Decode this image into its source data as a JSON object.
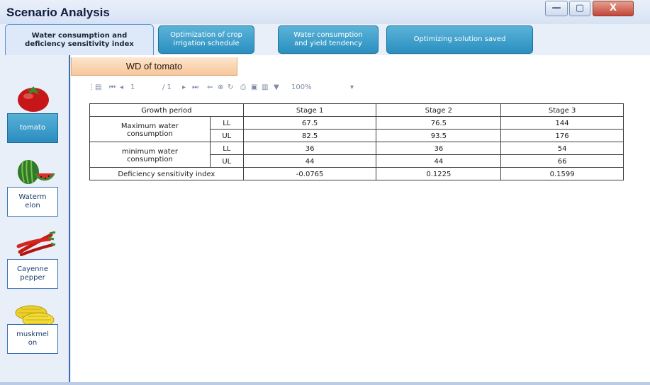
{
  "window": {
    "title": "Scenario Analysis",
    "minimize_glyph": "—",
    "maximize_glyph": "▢",
    "close_glyph": "X"
  },
  "tabs": [
    {
      "label_line1": "Water consumption  and",
      "label_line2": "deficiency  sensitivity  index"
    },
    {
      "label_line1": "Optimization  of crop",
      "label_line2": "irrigation  schedule"
    },
    {
      "label_line1": "Water consumption",
      "label_line2": "and yield tendency"
    },
    {
      "label_line1": "Optimizing  solution  saved",
      "label_line2": ""
    }
  ],
  "crops": [
    {
      "label_line1": "tomato",
      "label_line2": "",
      "icon": "tomato-icon",
      "selected": true
    },
    {
      "label_line1": "Waterm",
      "label_line2": "elon",
      "icon": "watermelon-icon"
    },
    {
      "label_line1": "Cayenne",
      "label_line2": "pepper",
      "icon": "pepper-icon"
    },
    {
      "label_line1": "muskmel",
      "label_line2": "on",
      "icon": "muskmelon-icon"
    }
  ],
  "panel": {
    "title": "WD of tomato"
  },
  "toolbar": {
    "page_current": "1",
    "page_total": "/ 1",
    "zoom": "100%",
    "zoom_arrow": "▾"
  },
  "table": {
    "header": [
      "Growth  period",
      "Stage 1",
      "Stage 2",
      "Stage 3"
    ],
    "max_label_line1": "Maximum  water",
    "max_label_line2": "consumption",
    "min_label_line1": "minimum  water",
    "min_label_line2": "consumption",
    "ll": "LL",
    "ul": "UL",
    "max_ll": [
      "67.5",
      "76.5",
      "144"
    ],
    "max_ul": [
      "82.5",
      "93.5",
      "176"
    ],
    "min_ll": [
      "36",
      "36",
      "54"
    ],
    "min_ul": [
      "44",
      "44",
      "66"
    ],
    "dsi_label": "Deficiency  sensitivity  index",
    "dsi": [
      "-0.0765",
      "0.1225",
      "0.1599"
    ]
  }
}
